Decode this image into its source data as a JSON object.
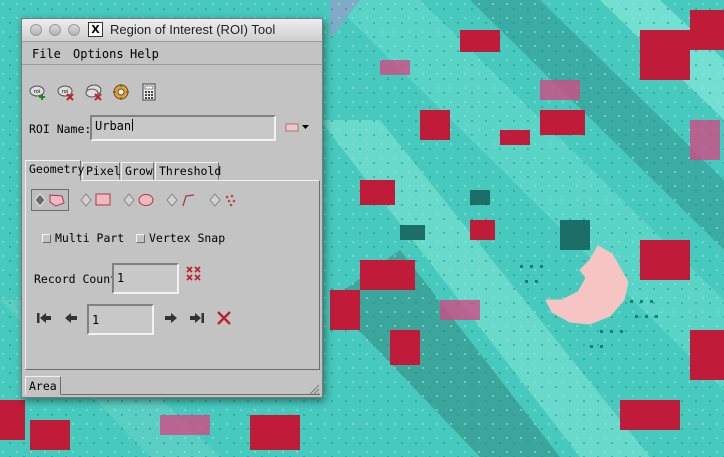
{
  "window": {
    "title": "Region of Interest (ROI) Tool",
    "x11_glyph": "X"
  },
  "menubar": {
    "file": "File",
    "options": "Options",
    "help": "Help"
  },
  "toolbar": [
    {
      "icon": "new-roi-icon"
    },
    {
      "icon": "delete-roi-icon"
    },
    {
      "icon": "delete-all-roi-icon"
    },
    {
      "icon": "roi-options-icon"
    },
    {
      "icon": "calculator-icon"
    }
  ],
  "roi_name": {
    "label": "ROI Name:",
    "value": "Urban",
    "color": "#f7c4c4"
  },
  "tabs": {
    "geometry": "Geometry",
    "pixel": "Pixel",
    "grow": "Grow",
    "threshold": "Threshold"
  },
  "shape_tools": [
    {
      "icon": "polygon-icon",
      "selected": true
    },
    {
      "icon": "rectangle-icon",
      "selected": false
    },
    {
      "icon": "ellipse-icon",
      "selected": false
    },
    {
      "icon": "polyline-icon",
      "selected": false
    },
    {
      "icon": "point-icon",
      "selected": false
    }
  ],
  "options": {
    "multi_part": "Multi Part",
    "vertex_snap": "Vertex Snap"
  },
  "record": {
    "label": "Record Count",
    "count": "1",
    "current": "1"
  },
  "bottom_tab": "Area",
  "colors": {
    "window_bg": "#c3c3c3",
    "roi_fill": "#f7c4c4",
    "accent_red": "#c0202a"
  }
}
